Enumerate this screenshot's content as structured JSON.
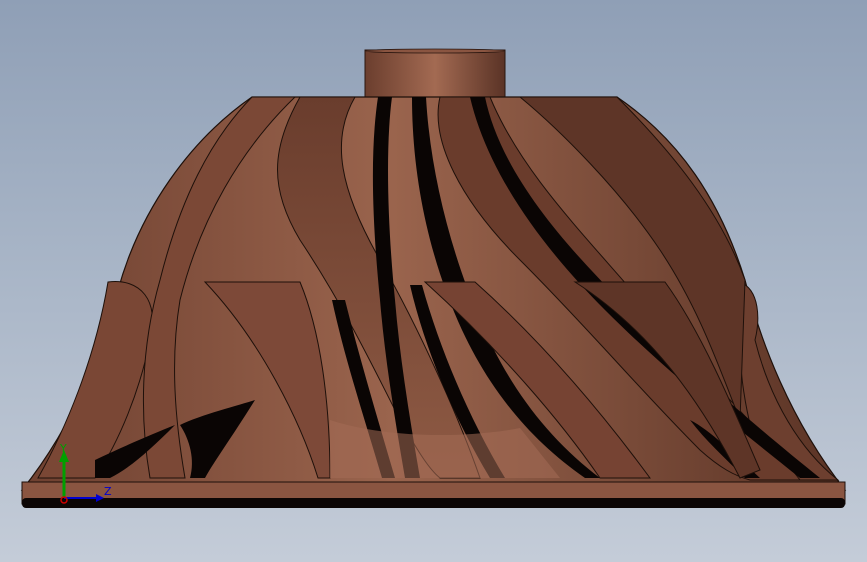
{
  "viewport": {
    "background_top": "#8f9fb6",
    "background_bottom": "#c4ccd8",
    "part_color": "#7a4a36",
    "part_shadow": "#4d2c20",
    "part_highlight": "#a66e56"
  },
  "triad": {
    "x_color": "#d00000",
    "y_color": "#00a000",
    "z_color": "#0000d0",
    "y_label": "Y",
    "z_label": "Z"
  }
}
